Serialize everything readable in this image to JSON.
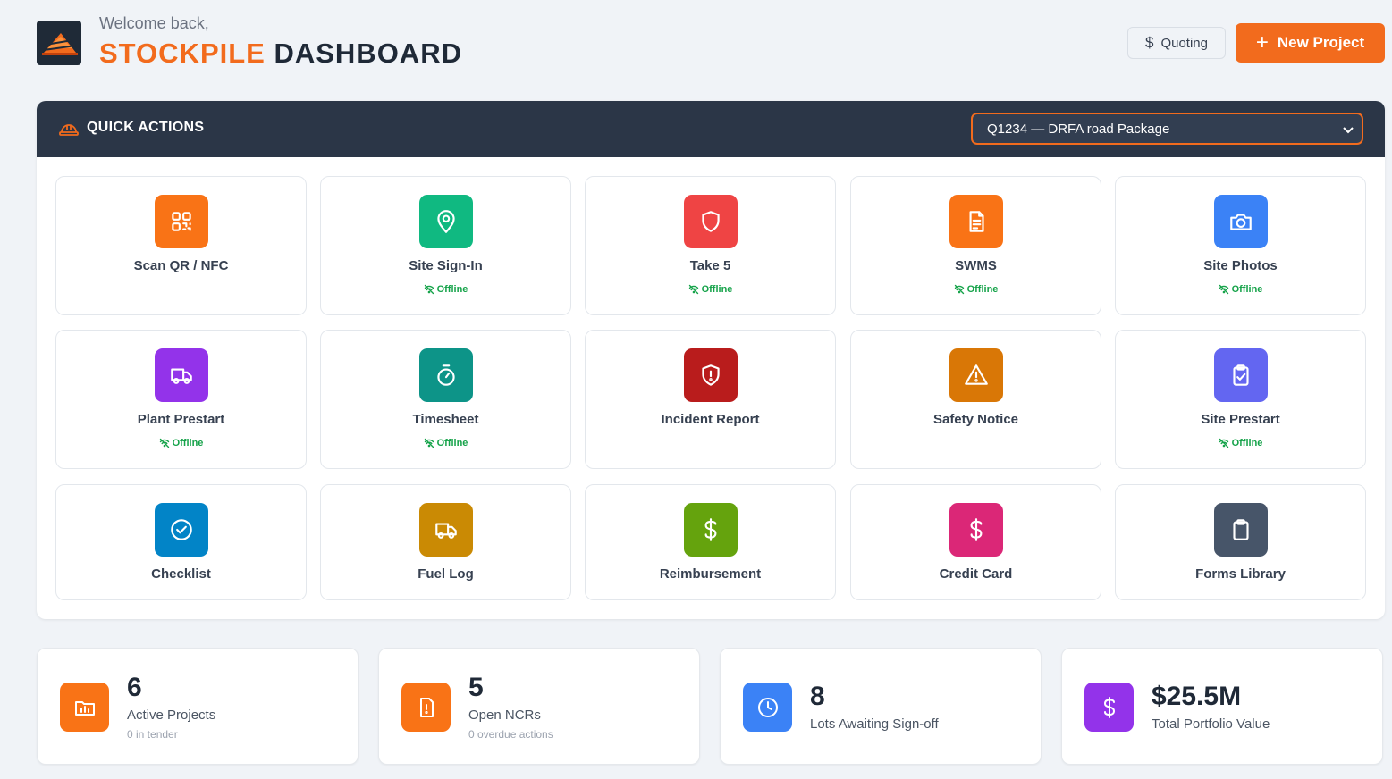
{
  "header": {
    "welcome": "Welcome back,",
    "title_accent": "STOCKPILE",
    "title_rest": "DASHBOARD",
    "quoting_label": "Quoting",
    "new_project_label": "New Project"
  },
  "quick_actions": {
    "title": "QUICK ACTIONS",
    "selected_project": "Q1234 — DRFA road Package",
    "offline_label": "Offline",
    "tiles": [
      {
        "label": "Scan QR / NFC",
        "icon": "qr-code-icon",
        "color": "#f97316",
        "offline": false
      },
      {
        "label": "Site Sign-In",
        "icon": "map-pin-icon",
        "color": "#10b981",
        "offline": true
      },
      {
        "label": "Take 5",
        "icon": "shield-icon",
        "color": "#ef4444",
        "offline": true
      },
      {
        "label": "SWMS",
        "icon": "document-icon",
        "color": "#f97316",
        "offline": true
      },
      {
        "label": "Site Photos",
        "icon": "camera-icon",
        "color": "#3b82f6",
        "offline": true
      },
      {
        "label": "Plant Prestart",
        "icon": "truck-icon",
        "color": "#9333ea",
        "offline": true
      },
      {
        "label": "Timesheet",
        "icon": "timer-icon",
        "color": "#0d9488",
        "offline": true
      },
      {
        "label": "Incident Report",
        "icon": "shield-alert-icon",
        "color": "#b91c1c",
        "offline": false
      },
      {
        "label": "Safety Notice",
        "icon": "warning-icon",
        "color": "#d97706",
        "offline": false
      },
      {
        "label": "Site Prestart",
        "icon": "clipboard-check-icon",
        "color": "#6366f1",
        "offline": true
      },
      {
        "label": "Checklist",
        "icon": "check-circle-icon",
        "color": "#0284c7",
        "offline": false
      },
      {
        "label": "Fuel Log",
        "icon": "truck-icon",
        "color": "#ca8a04",
        "offline": false
      },
      {
        "label": "Reimbursement",
        "icon": "dollar-icon",
        "color": "#65a30d",
        "offline": false
      },
      {
        "label": "Credit Card",
        "icon": "dollar-icon",
        "color": "#db2777",
        "offline": false
      },
      {
        "label": "Forms Library",
        "icon": "clipboard-icon",
        "color": "#475569",
        "offline": false
      }
    ]
  },
  "stats": [
    {
      "value": "6",
      "label": "Active Projects",
      "sub": "0 in tender",
      "icon": "folder-chart-icon",
      "color": "#f97316"
    },
    {
      "value": "5",
      "label": "Open NCRs",
      "sub": "0 overdue actions",
      "icon": "file-alert-icon",
      "color": "#f97316"
    },
    {
      "value": "8",
      "label": "Lots Awaiting Sign-off",
      "sub": "",
      "icon": "clock-icon",
      "color": "#3b82f6"
    },
    {
      "value": "$25.5M",
      "label": "Total Portfolio Value",
      "sub": "",
      "icon": "dollar-icon",
      "color": "#9333ea"
    }
  ]
}
